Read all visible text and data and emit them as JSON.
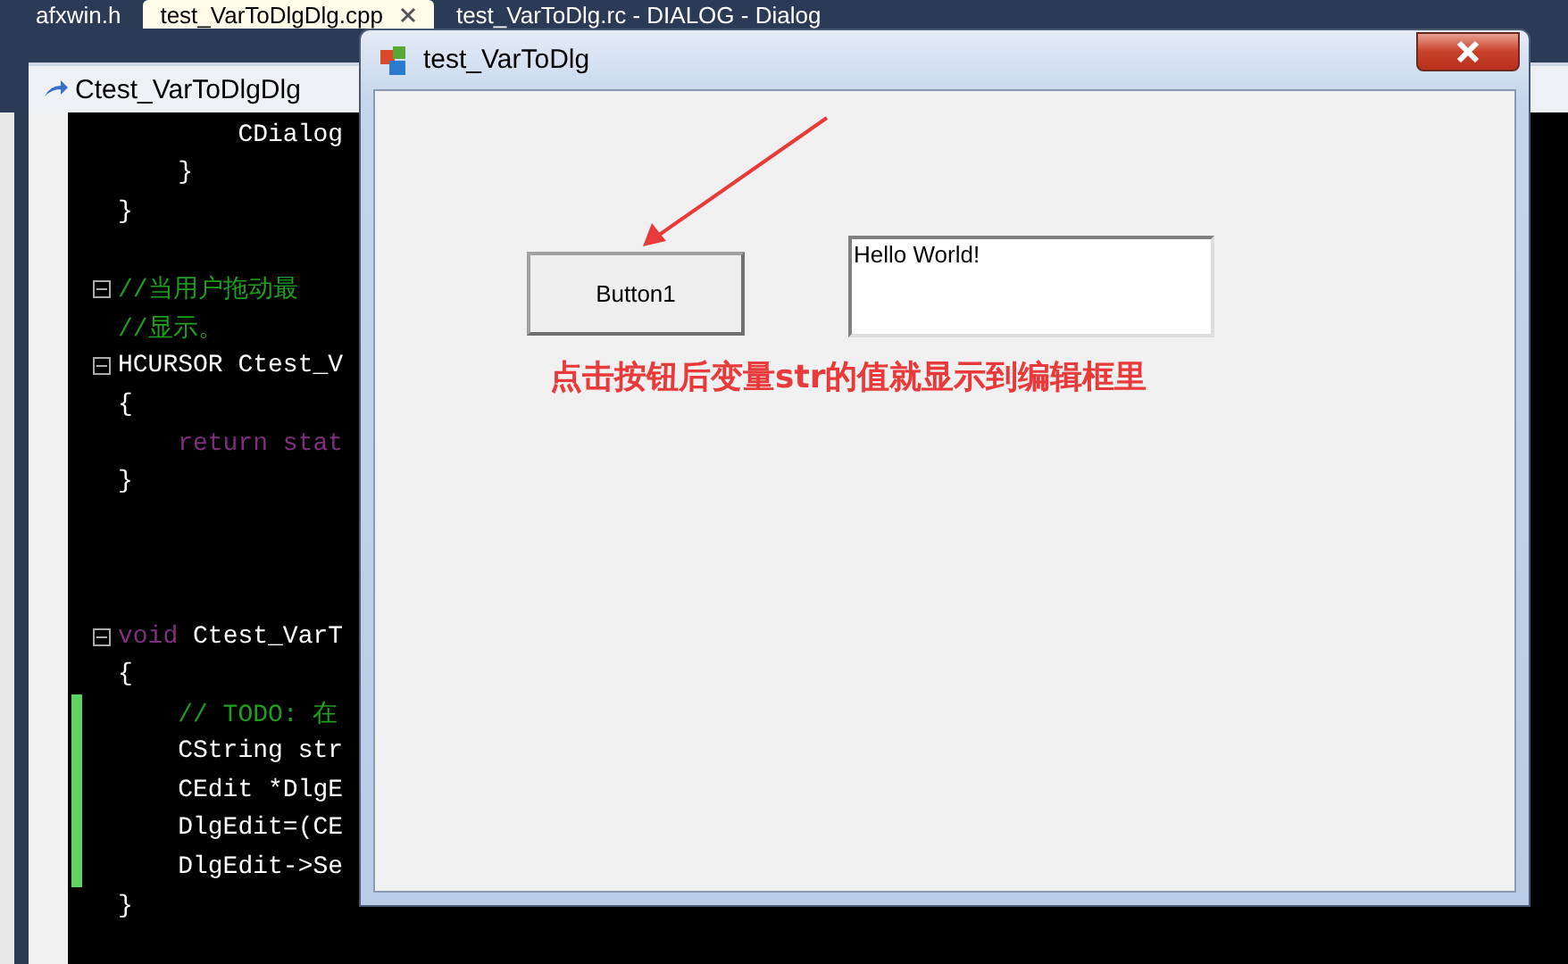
{
  "tabs": [
    {
      "label": "afxwin.h",
      "selected": false,
      "closable": false
    },
    {
      "label": "test_VarToDlgDlg.cpp",
      "selected": true,
      "closable": true
    },
    {
      "label": "test_VarToDlg.rc - DIALOG - Dialog",
      "selected": false,
      "closable": false
    }
  ],
  "navigation_bar": {
    "class_name": "Ctest_VarToDlgDlg"
  },
  "editor": {
    "lines": [
      {
        "kind": "code",
        "fold": false,
        "changed": false,
        "tokens": [
          {
            "kind": "plain",
            "text": "        CDialog"
          }
        ]
      },
      {
        "kind": "code",
        "fold": false,
        "changed": false,
        "tokens": [
          {
            "kind": "plain",
            "text": "    }"
          }
        ]
      },
      {
        "kind": "code",
        "fold": false,
        "changed": false,
        "tokens": [
          {
            "kind": "plain",
            "text": "}"
          }
        ]
      },
      {
        "kind": "blank"
      },
      {
        "kind": "code",
        "fold": true,
        "changed": false,
        "tokens": [
          {
            "kind": "comment",
            "text": "//当用户拖动最"
          }
        ]
      },
      {
        "kind": "code",
        "fold": false,
        "changed": false,
        "tokens": [
          {
            "kind": "comment",
            "text": "//显示。"
          }
        ]
      },
      {
        "kind": "code",
        "fold": true,
        "changed": false,
        "tokens": [
          {
            "kind": "plain",
            "text": "HCURSOR Ctest_V"
          }
        ]
      },
      {
        "kind": "code",
        "fold": false,
        "changed": false,
        "tokens": [
          {
            "kind": "plain",
            "text": "{"
          }
        ]
      },
      {
        "kind": "code",
        "fold": false,
        "changed": false,
        "tokens": [
          {
            "kind": "keyword",
            "text": "    return stat"
          }
        ]
      },
      {
        "kind": "code",
        "fold": false,
        "changed": false,
        "tokens": [
          {
            "kind": "plain",
            "text": "}"
          }
        ]
      },
      {
        "kind": "blank"
      },
      {
        "kind": "blank"
      },
      {
        "kind": "blank"
      },
      {
        "kind": "code",
        "fold": true,
        "changed": false,
        "tokens": [
          {
            "kind": "keyword",
            "text": "void"
          },
          {
            "kind": "plain",
            "text": " Ctest_VarT"
          }
        ]
      },
      {
        "kind": "code",
        "fold": false,
        "changed": false,
        "tokens": [
          {
            "kind": "plain",
            "text": "{"
          }
        ]
      },
      {
        "kind": "code",
        "fold": false,
        "changed": true,
        "tokens": [
          {
            "kind": "comment",
            "text": "    // TODO: 在"
          }
        ]
      },
      {
        "kind": "code",
        "fold": false,
        "changed": true,
        "tokens": [
          {
            "kind": "plain",
            "text": "    CString str"
          }
        ]
      },
      {
        "kind": "code",
        "fold": false,
        "changed": true,
        "tokens": [
          {
            "kind": "plain",
            "text": "    CEdit *DlgE"
          }
        ]
      },
      {
        "kind": "code",
        "fold": false,
        "changed": true,
        "tokens": [
          {
            "kind": "plain",
            "text": "    DlgEdit=(CE"
          }
        ]
      },
      {
        "kind": "code",
        "fold": false,
        "changed": true,
        "tokens": [
          {
            "kind": "plain",
            "text": "    DlgEdit->Se"
          }
        ]
      },
      {
        "kind": "code",
        "fold": false,
        "changed": false,
        "tokens": [
          {
            "kind": "plain",
            "text": "}"
          }
        ]
      }
    ]
  },
  "dialog": {
    "title": "test_VarToDlg",
    "button": "Button1",
    "edit_value": "Hello World!"
  },
  "annotation": {
    "text": "点击按钮后变量str的值就显示到编辑框里"
  }
}
